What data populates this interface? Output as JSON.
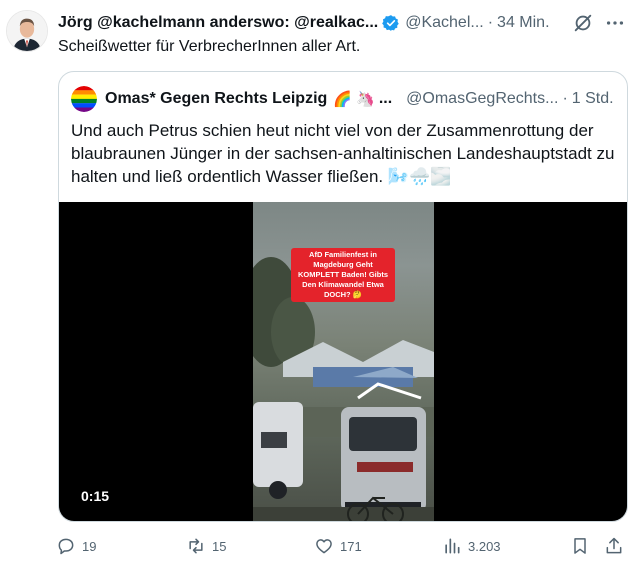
{
  "tweet": {
    "author_name": "Jörg @kachelmann anderswo: @realkac...",
    "handle": "@Kachel...",
    "separator": "·",
    "time": "34 Min.",
    "text": "Scheißwetter für VerbrecherInnen aller Art."
  },
  "quote": {
    "author_name": "Omas* Gegen Rechts Leipzig",
    "emojis": "🌈 🦄",
    "ellipsis": "...",
    "handle": "@OmasGegRechts...",
    "separator": "·",
    "time": "1 Std.",
    "text": "Und auch Petrus schien heut nicht viel von der Zusammenrottung der blaubraunen Jünger in der sachsen-anhaltinischen Landeshauptstadt zu halten und ließ ordentlich Wasser fließen. 🌬️🌧️🌫️",
    "video": {
      "overlay_caption": "AfD Familienfest in Magdeburg Geht KOMPLETT Baden! Gibts Den Klimawandel Etwa DOCH? 🤔",
      "duration": "0:15"
    }
  },
  "actions": {
    "replies": "19",
    "reposts": "15",
    "likes": "171",
    "views": "3.203"
  },
  "colors": {
    "text_primary": "#0f1419",
    "text_secondary": "#536471",
    "verified_blue": "#1d9bf0",
    "border": "#cfd9de",
    "caption_red": "#e4232b"
  },
  "icons": [
    "verified-badge-icon",
    "grok-icon",
    "more-icon",
    "reply-icon",
    "repost-icon",
    "like-icon",
    "views-icon",
    "bookmark-icon",
    "share-icon"
  ]
}
